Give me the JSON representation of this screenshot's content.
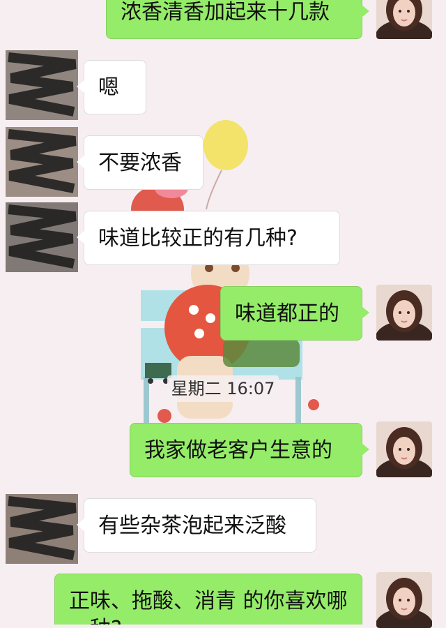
{
  "conversation": {
    "messages": [
      {
        "side": "self",
        "text": "浓香清香加起来十几款"
      },
      {
        "side": "other",
        "text": "嗯"
      },
      {
        "side": "other",
        "text": "不要浓香"
      },
      {
        "side": "other",
        "text": "味道比较正的有几种?"
      },
      {
        "side": "self",
        "text": "味道都正的"
      },
      {
        "side": "self",
        "text": "我家做老客户生意的"
      },
      {
        "side": "other",
        "text": "有些杂茶泡起来泛酸"
      },
      {
        "side": "self",
        "text": "正味、拖酸、消青 的你喜欢哪一种?"
      }
    ],
    "timestamp": "星期二 16:07"
  },
  "colors": {
    "self_bubble": "#95ec69",
    "other_bubble": "#ffffff",
    "background": "#f6eef1"
  },
  "icons": {
    "self_avatar": "avatar-girl-photo",
    "other_avatar": "avatar-blurred-photo"
  }
}
